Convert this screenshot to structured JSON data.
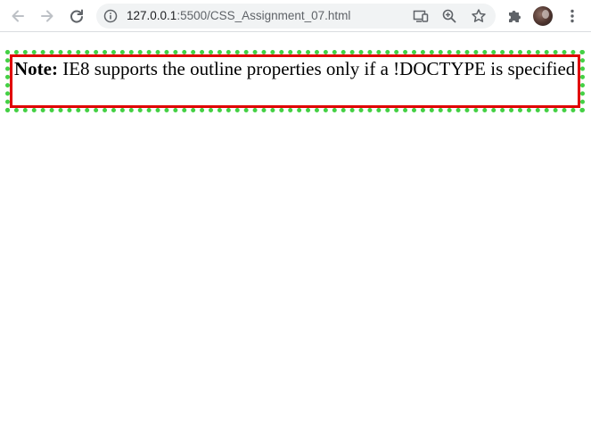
{
  "browser": {
    "url_host": "127.0.0.1",
    "url_path": ":5500/CSS_Assignment_07.html",
    "icons": {
      "back": "arrow-left-icon",
      "forward": "arrow-right-icon",
      "reload": "reload-icon",
      "site_info": "info-icon",
      "cast": "cast-icon",
      "zoom": "zoom-icon",
      "bookmark": "star-icon",
      "extensions": "puzzle-icon",
      "menu": "kebab-menu-icon"
    }
  },
  "content": {
    "note_label": "Note:",
    "note_text": " IE8 supports the outline properties only if a !DOCTYPE is specified"
  },
  "colors": {
    "border": "#e00000",
    "outline": "#44d044"
  }
}
